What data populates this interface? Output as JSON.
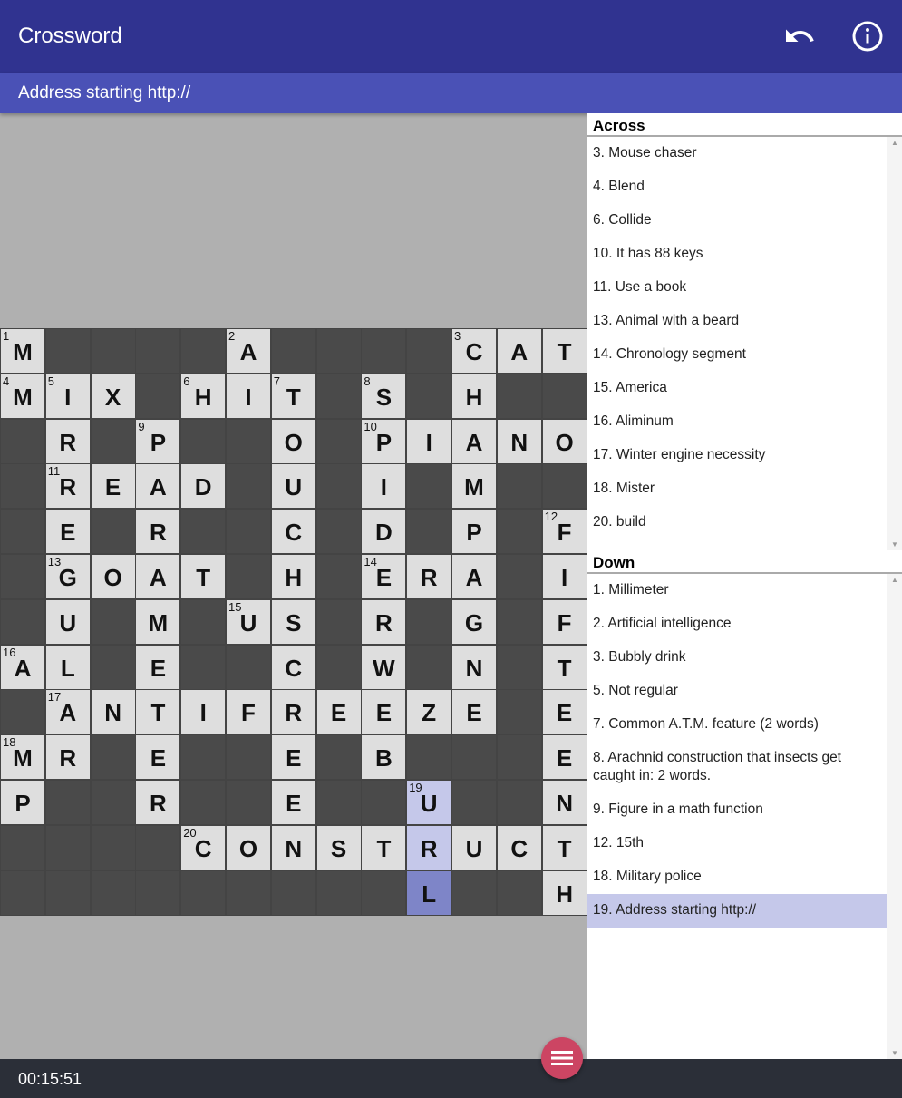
{
  "app": {
    "title": "Crossword",
    "undo_icon": "undo-icon",
    "info_icon": "info-icon"
  },
  "current_clue": "Address starting http://",
  "timer": "00:15:51",
  "menu_icon": "menu-icon",
  "colors": {
    "appbar": "#303390",
    "subbar": "#4a51b6",
    "highlight": "#c5c8ea",
    "cursor": "#7e85c8",
    "fab": "#cc4563"
  },
  "grid": {
    "rows": [
      "M####A####CAT",
      "MIX#HIT#S#H##",
      "#R#P##O#PIANO",
      "#READ#U#I#M##",
      "#E#R##C#D#P#F",
      "#GOAT#H#ERA#I",
      "#U#M#US#R#G#F",
      "AL#E##C#W#N#T",
      "#ANTIFREEZE#E",
      "MR#E##E#B###E",
      "P##R##E##U##N",
      "####CONSTRUCT",
      "#########L##H"
    ],
    "numbers": [
      [
        0,
        0,
        1
      ],
      [
        0,
        5,
        2
      ],
      [
        0,
        10,
        3
      ],
      [
        1,
        0,
        4
      ],
      [
        1,
        1,
        5
      ],
      [
        1,
        4,
        6
      ],
      [
        1,
        6,
        7
      ],
      [
        1,
        8,
        8
      ],
      [
        2,
        3,
        9
      ],
      [
        2,
        8,
        10
      ],
      [
        3,
        1,
        11
      ],
      [
        4,
        12,
        12
      ],
      [
        5,
        1,
        13
      ],
      [
        5,
        8,
        14
      ],
      [
        6,
        5,
        15
      ],
      [
        7,
        0,
        16
      ],
      [
        8,
        1,
        17
      ],
      [
        9,
        0,
        18
      ],
      [
        10,
        9,
        19
      ],
      [
        11,
        4,
        20
      ]
    ],
    "highlighted": [
      [
        10,
        9
      ],
      [
        11,
        9
      ]
    ],
    "cursor": [
      12,
      9
    ]
  },
  "across": {
    "title": "Across",
    "clues": [
      "3. Mouse chaser",
      "4. Blend",
      "6. Collide",
      "10. It has 88 keys",
      "11. Use a book",
      "13. Animal with a beard",
      "14. Chronology segment",
      "15. America",
      "16. Aliminum",
      "17. Winter engine necessity",
      "18. Mister",
      "20. build"
    ]
  },
  "down": {
    "title": "Down",
    "selected": 9,
    "clues": [
      "1. Millimeter",
      "2. Artificial intelligence",
      "3. Bubbly drink",
      "5. Not regular",
      "7. Common A.T.M. feature (2 words)",
      "8. Arachnid construction that insects get caught in: 2 words.",
      "9. Figure in a math function",
      "12. 15th",
      "18. Military police",
      "19. Address starting http://"
    ]
  }
}
